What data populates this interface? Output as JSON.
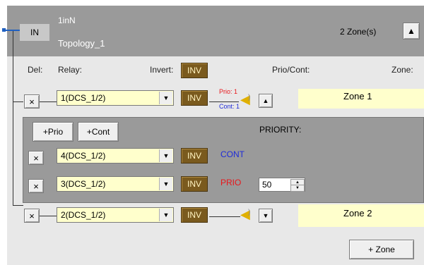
{
  "top": {
    "in_label": "IN",
    "name": "1inN",
    "topology": "Topology_1",
    "zone_count": "2 Zone(s)",
    "collapse_icon": "triangle-up-icon"
  },
  "headers": {
    "del": "Del:",
    "relay": "Relay:",
    "invert": "Invert:",
    "invert_btn": "INV",
    "prio_cont": "Prio/Cont:",
    "zone": "Zone:"
  },
  "row1": {
    "delete": "×",
    "relay_value": "1(DCS_1/2)",
    "inv": "INV",
    "prio_label": "Prio: 1",
    "cont_label": "Cont: 1",
    "zone": "Zone 1"
  },
  "priority_panel": {
    "add_prio": "+Prio",
    "add_cont": "+Cont",
    "title": "PRIORITY:",
    "rows": [
      {
        "delete": "×",
        "relay_value": "4(DCS_1/2)",
        "inv": "INV",
        "kind": "CONT",
        "kind_color": "#1f2bd8"
      },
      {
        "delete": "×",
        "relay_value": "3(DCS_1/2)",
        "inv": "INV",
        "kind": "PRIO",
        "kind_color": "#e8161b",
        "value": "50"
      }
    ]
  },
  "row2": {
    "delete": "×",
    "relay_value": "2(DCS_1/2)",
    "inv": "INV",
    "zone": "Zone 2"
  },
  "footer": {
    "add_zone": "+ Zone"
  }
}
